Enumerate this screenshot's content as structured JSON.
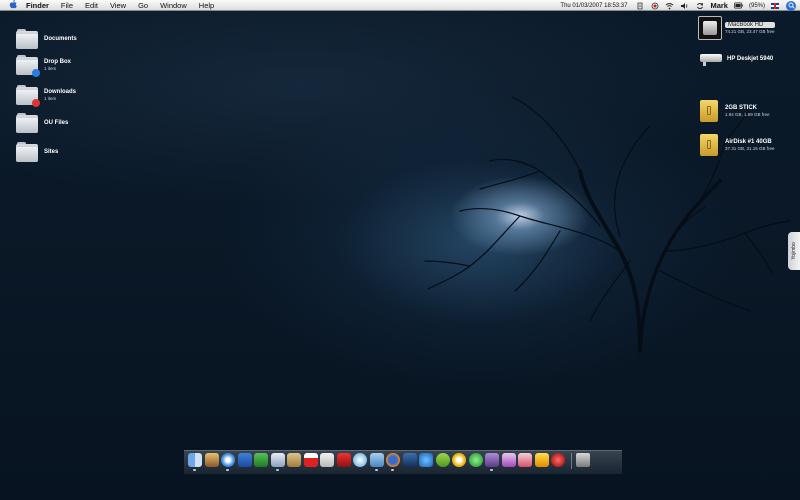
{
  "menubar": {
    "items": [
      "Finder",
      "File",
      "Edit",
      "View",
      "Go",
      "Window",
      "Help"
    ],
    "clock": "Thu 01/03/2007 18:53:37",
    "user": "Mark",
    "battery": "(95%)",
    "status_icons": [
      "script-icon",
      "record-icon",
      "wifi-icon",
      "volume-icon",
      "sync-icon",
      "battery-icon",
      "flag-uk-icon",
      "spotlight-icon"
    ]
  },
  "desktop_left": [
    {
      "label": "Documents",
      "sub": ""
    },
    {
      "label": "Drop Box",
      "sub": "1 item"
    },
    {
      "label": "Downloads",
      "sub": "1 item"
    },
    {
      "label": "OU Files",
      "sub": ""
    },
    {
      "label": "Sites",
      "sub": ""
    }
  ],
  "desktop_right": [
    {
      "label": "MacBook HD",
      "sub": "74.21 GB, 23.47 GB free"
    },
    {
      "label": "HP Deskjet 5940",
      "sub": ""
    },
    {
      "label": "2GB STICK",
      "sub": "1.94 GB, 1.69 GB free"
    },
    {
      "label": "AirDisk #1 40GB",
      "sub": "37.31 GB, 31.15 GB free"
    }
  ],
  "yojimbo": "Yojimbo",
  "dock": {
    "icons": [
      "finder-icon",
      "photo-icon",
      "safari-icon",
      "word-icon",
      "excel-icon",
      "preview-icon",
      "notebook-icon",
      "ical-icon",
      "calculator-icon",
      "fireworks-icon",
      "itunes-icon",
      "mail-icon",
      "firefox-icon",
      "web-icon",
      "iweb-icon",
      "skype-icon",
      "network-icon",
      "textmate-icon",
      "graphic-icon",
      "openoffice-icon",
      "dreamweaver-icon",
      "ical-stamp-icon",
      "shell-icon",
      "trash-icon"
    ]
  }
}
